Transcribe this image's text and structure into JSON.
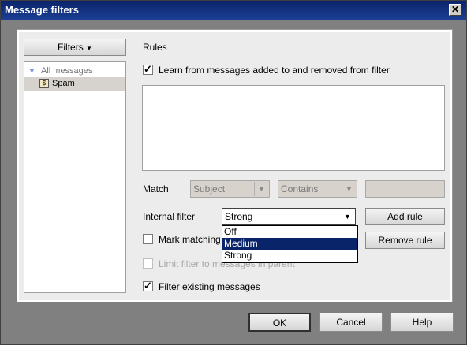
{
  "window": {
    "title": "Message filters",
    "close_label": "✕"
  },
  "filters_button": {
    "label": "Filters",
    "icon": "caret-down-icon"
  },
  "tree": {
    "items": [
      {
        "label": "All messages",
        "icon": "triangle-expand-icon"
      },
      {
        "label": "Spam",
        "icon": "filter-icon",
        "selected": true
      }
    ]
  },
  "rules": {
    "heading": "Rules",
    "learn_label": "Learn from messages added to and removed from filter",
    "learn_checked": true,
    "match_label": "Match",
    "match_field": "Subject",
    "match_op": "Contains",
    "match_value": ""
  },
  "internal_filter": {
    "label": "Internal filter",
    "value": "Strong",
    "options": [
      "Off",
      "Medium",
      "Strong"
    ],
    "highlighted": "Medium"
  },
  "mark_matching_label": "Mark matching m",
  "limit_label": "Limit filter to messages in parent",
  "filter_existing_label": "Filter existing messages",
  "buttons": {
    "add_rule": "Add rule",
    "remove_rule": "Remove rule",
    "ok": "OK",
    "cancel": "Cancel",
    "help": "Help"
  },
  "colors": {
    "titlebar": "#0a246a",
    "selection": "#0a246a"
  }
}
